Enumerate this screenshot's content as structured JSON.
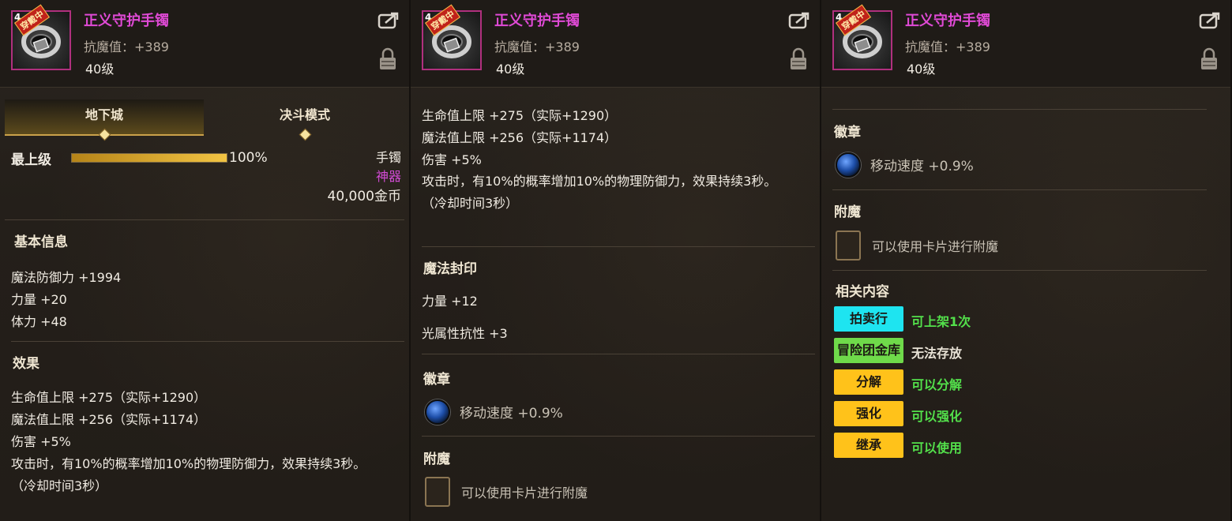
{
  "item": {
    "name": "正义守护手镯",
    "resist": "抗魔值：+389",
    "level": "40级",
    "tier": "4",
    "equip_tag": "穿戴中"
  },
  "tabs": [
    "地下城",
    "决斗模式"
  ],
  "grade": {
    "label": "最上级",
    "percent": 1.0,
    "percent_text": "100%"
  },
  "slot": "手镯",
  "rarity": "神器",
  "price": "40,000金币",
  "basic": {
    "title": "基本信息",
    "lines": [
      "魔法防御力 +1994",
      "力量 +20",
      "体力 +48"
    ]
  },
  "effect": {
    "title": "效果",
    "lines": [
      "生命值上限 +275（实际+1290）",
      "魔法值上限 +256（实际+1174）",
      "伤害 +5%"
    ],
    "desc": "攻击时，有10%的概率增加10%的物理防御力，效果持续3秒。（冷却时间3秒）"
  },
  "seal": {
    "title": "魔法封印",
    "lines": [
      "力量 +12",
      "光属性抗性 +3"
    ]
  },
  "emblem": {
    "title": "徽章",
    "text": "移动速度 +0.9%"
  },
  "enchant": {
    "title": "附魔",
    "text": "可以使用卡片进行附魔"
  },
  "related": {
    "title": "相关内容",
    "items": [
      {
        "label": "拍卖行",
        "note": "可上架1次",
        "color": "#1ee4f0",
        "note_color": "#53e04b"
      },
      {
        "label": "冒险团金库",
        "note": "无法存放",
        "color": "#6fda4a",
        "note_color": "#e8e2d6"
      },
      {
        "label": "分解",
        "note": "可以分解",
        "color": "#ffc21a",
        "note_color": "#53e04b"
      },
      {
        "label": "强化",
        "note": "可以强化",
        "color": "#ffc21a",
        "note_color": "#53e04b"
      },
      {
        "label": "继承",
        "note": "可以使用",
        "color": "#ffc21a",
        "note_color": "#53e04b"
      }
    ]
  },
  "icons": {
    "share": "share-icon",
    "lock": "lock-icon",
    "emblem": "blue-orb-icon",
    "card": "card-slot-icon",
    "item": "bracelet-icon"
  }
}
